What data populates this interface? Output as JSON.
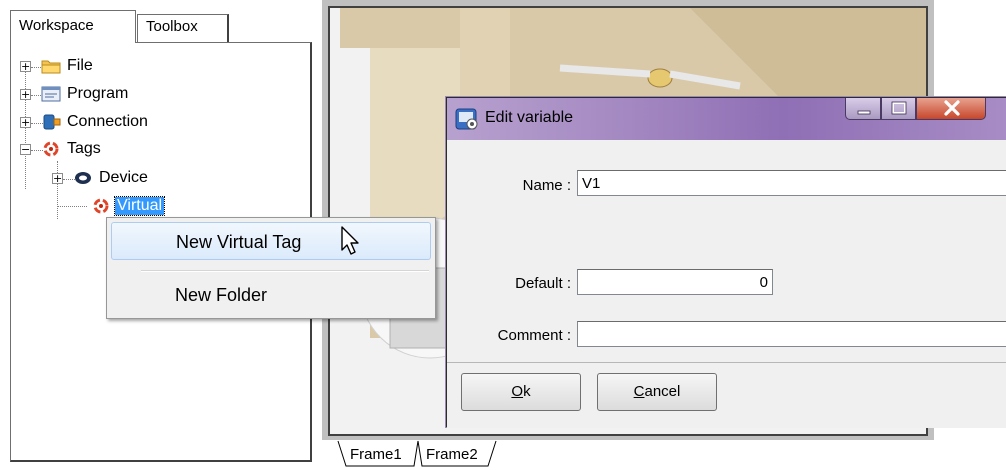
{
  "workspace": {
    "tabs": [
      {
        "label": "Workspace",
        "active": true
      },
      {
        "label": "Toolbox",
        "active": false
      }
    ],
    "tree": [
      {
        "label": "File",
        "expander": "+",
        "icon": "folder-icon"
      },
      {
        "label": "Program",
        "expander": "+",
        "icon": "program-icon"
      },
      {
        "label": "Connection",
        "expander": "+",
        "icon": "connection-icon"
      },
      {
        "label": "Tags",
        "expander": "−",
        "icon": "tags-icon"
      },
      {
        "label": "Device",
        "expander": "+",
        "icon": "device-icon"
      },
      {
        "label": "Virtual",
        "icon": "tags-icon",
        "selected": true
      }
    ]
  },
  "context_menu": {
    "items": [
      {
        "label": "New Virtual Tag",
        "highlighted": true
      },
      {
        "label": "New Folder",
        "highlighted": false
      }
    ]
  },
  "frame_tabs": [
    {
      "label": "Frame1"
    },
    {
      "label": "Frame2"
    }
  ],
  "dialog": {
    "title": "Edit variable",
    "fields": {
      "name": {
        "label": "Name :",
        "value": "V1"
      },
      "default": {
        "label": "Default :",
        "value": "0"
      },
      "comment": {
        "label": "Comment :",
        "value": ""
      }
    },
    "buttons": {
      "ok": {
        "mnemonic": "O",
        "rest": "k"
      },
      "cancel": {
        "mnemonic": "C",
        "rest": "ancel"
      }
    }
  },
  "colors": {
    "selection": "#3399ff",
    "titlebar": "#a58ac2",
    "close_button": "#c7462c"
  }
}
